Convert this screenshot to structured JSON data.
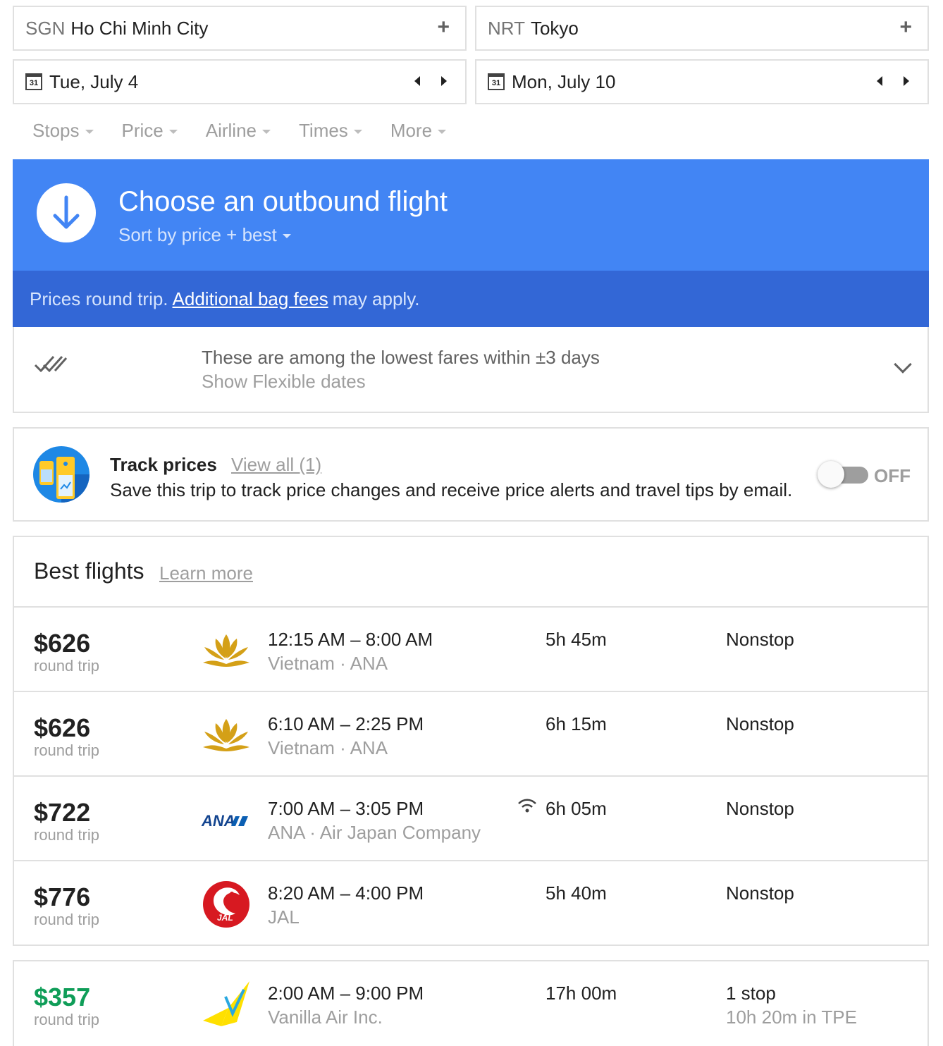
{
  "origin": {
    "code": "SGN",
    "city": "Ho Chi Minh City"
  },
  "destination": {
    "code": "NRT",
    "city": "Tokyo"
  },
  "depart_date": {
    "cal_num": "31",
    "label": "Tue, July 4"
  },
  "return_date": {
    "cal_num": "31",
    "label": "Mon, July 10"
  },
  "filters": [
    "Stops",
    "Price",
    "Airline",
    "Times",
    "More"
  ],
  "header": {
    "title": "Choose an outbound flight",
    "sort_label": "Sort by price + best",
    "notice_prefix": "Prices round trip.",
    "notice_link": "Additional bag fees",
    "notice_suffix": "may apply."
  },
  "fares": {
    "message": "These are among the lowest fares within ±3 days",
    "link": "Show Flexible dates"
  },
  "track": {
    "title": "Track prices",
    "view_all": "View all (1)",
    "description": "Save this trip to track price changes and receive price alerts and travel tips by email.",
    "toggle_label": "OFF"
  },
  "best": {
    "title": "Best flights",
    "learn_more": "Learn more",
    "flights": [
      {
        "price": "$626",
        "trip": "round trip",
        "times": "12:15 AM – 8:00 AM",
        "airline": "Vietnam · ANA",
        "duration": "5h 45m",
        "stops": "Nonstop",
        "logo": "vietnam-airlines-lotus"
      },
      {
        "price": "$626",
        "trip": "round trip",
        "times": "6:10 AM – 2:25 PM",
        "airline": "Vietnam · ANA",
        "duration": "6h 15m",
        "stops": "Nonstop",
        "logo": "vietnam-airlines-lotus"
      },
      {
        "price": "$722",
        "trip": "round trip",
        "times": "7:00 AM – 3:05 PM",
        "airline": "ANA · Air Japan Company",
        "duration": "6h 05m",
        "stops": "Nonstop",
        "logo": "ana",
        "logo_text": "ANA",
        "wifi": true
      },
      {
        "price": "$776",
        "trip": "round trip",
        "times": "8:20 AM – 4:00 PM",
        "airline": "JAL",
        "duration": "5h 40m",
        "stops": "Nonstop",
        "logo": "jal-crane",
        "logo_text": "JAL"
      }
    ]
  },
  "other": {
    "flights": [
      {
        "price": "$357",
        "trip": "round trip",
        "times": "2:00 AM – 9:00 PM",
        "airline": "Vanilla Air Inc.",
        "duration": "17h 00m",
        "stops": "1 stop",
        "layover": "10h 20m in TPE",
        "logo": "vanilla-air",
        "price_color": "#0f9d58"
      }
    ]
  },
  "colors": {
    "primary_blue": "#4285f4",
    "dark_blue": "#3367d6",
    "cheap_green": "#0f9d58"
  }
}
